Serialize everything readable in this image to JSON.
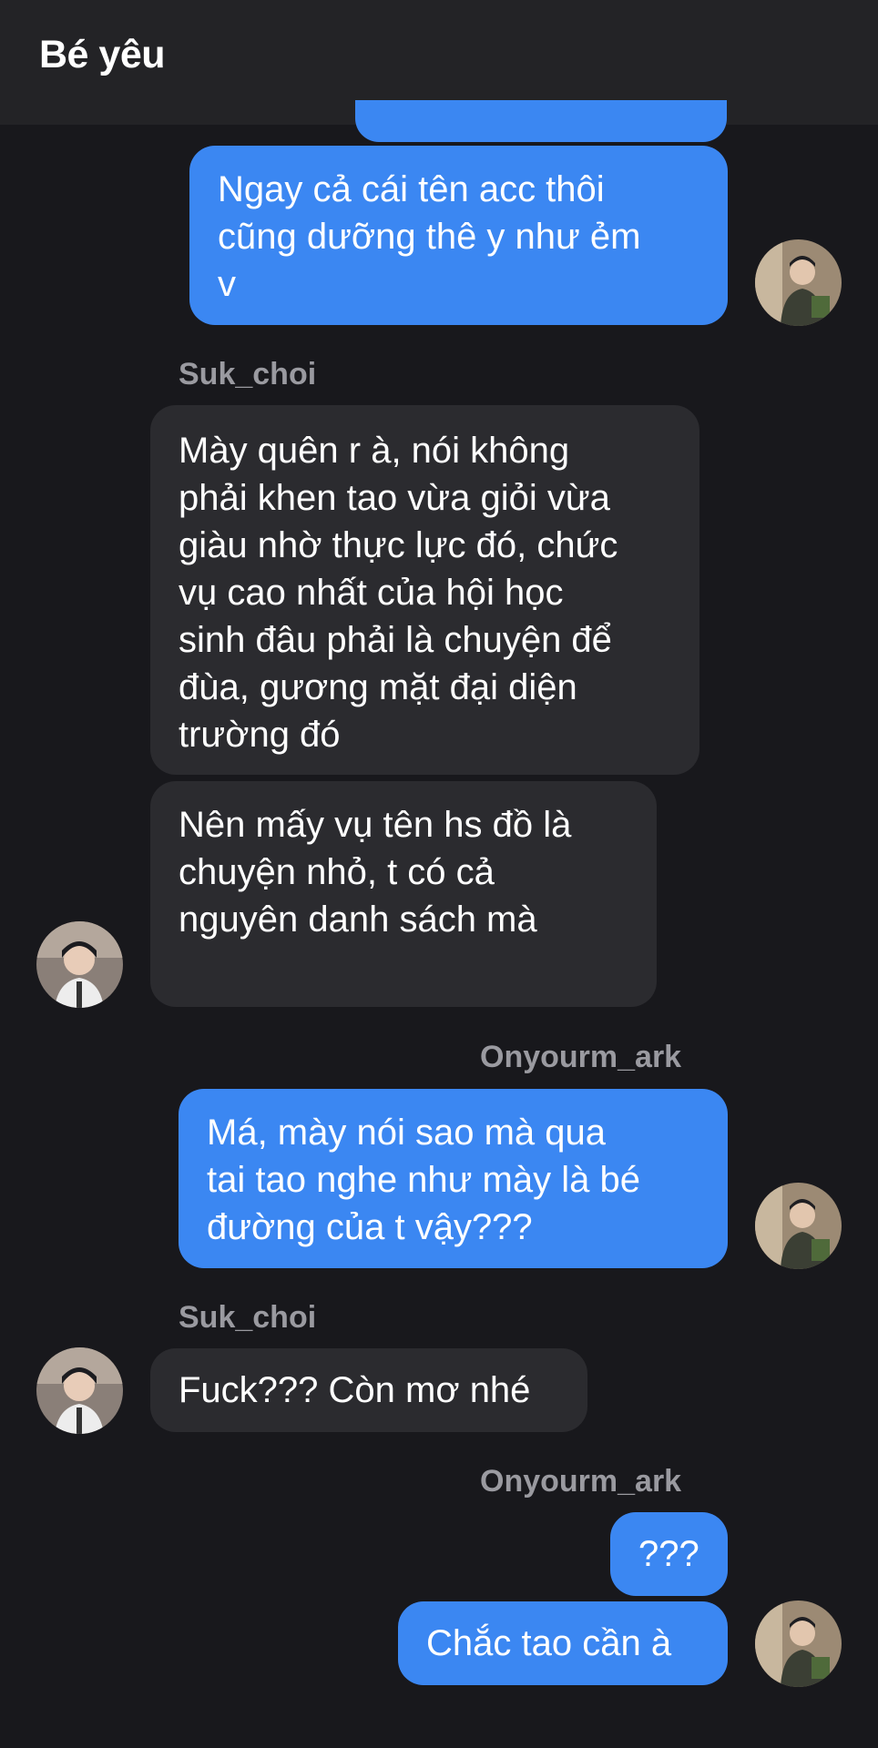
{
  "header": {
    "title": "Bé yêu"
  },
  "messages": [
    {
      "sender": "",
      "text": "Ngay cả cái tên acc thôi\ncũng dưỡng thê y như ẻm\nv"
    },
    {
      "sender": "Suk_choi",
      "text": "Mày quên r à, nói không\nphải khen tao vừa giỏi vừa\ngiàu nhờ thực lực đó, chức\nvụ cao nhất của hội học\nsinh đâu phải là chuyện để\nđùa, gương mặt đại diện\ntrường đó"
    },
    {
      "sender": "",
      "text": "Nên mấy vụ tên hs đồ là\nchuyện nhỏ, t có cả\nnguyên danh sách mà"
    },
    {
      "sender": "Onyourm_ark",
      "text": "Má, mày nói sao mà qua\ntai tao nghe như mày là bé\nđường của t vậy???"
    },
    {
      "sender": "Suk_choi",
      "text": "Fuck??? Còn mơ nhé"
    },
    {
      "sender": "Onyourm_ark",
      "text": "???"
    },
    {
      "sender": "",
      "text": "Chắc tao cần à"
    }
  ],
  "colors": {
    "outgoing": "#3b87f2",
    "incoming": "#2b2b2f",
    "background": "#18181c"
  }
}
